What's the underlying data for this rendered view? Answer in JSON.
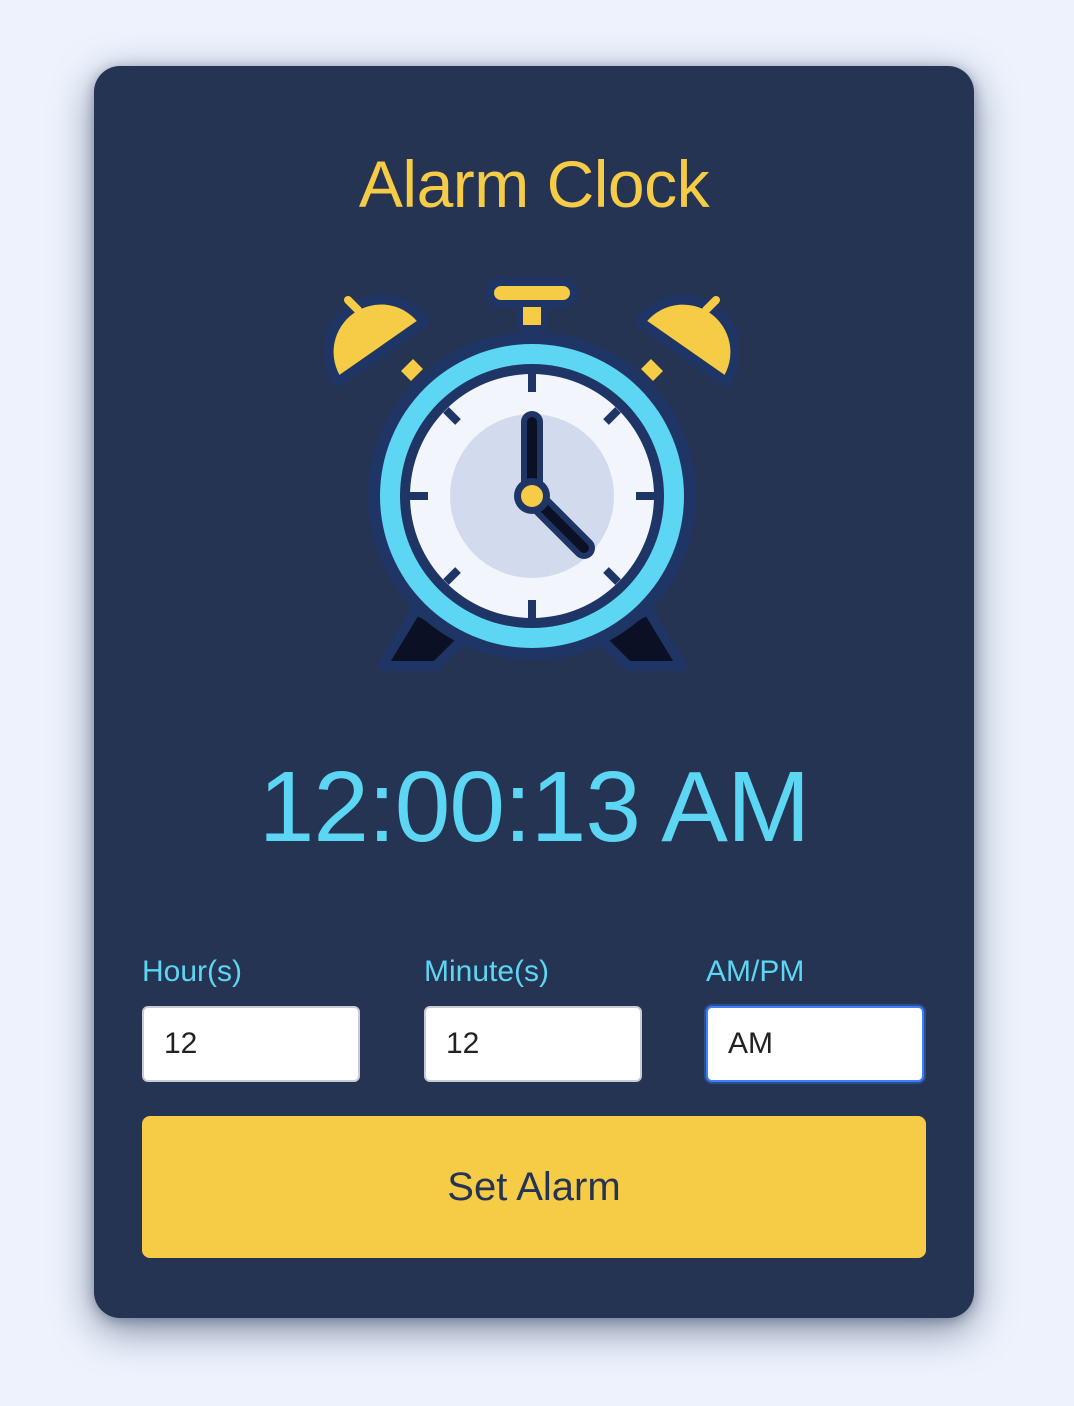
{
  "app": {
    "title": "Alarm Clock",
    "current_time": "12:00:13 AM"
  },
  "form": {
    "hour": {
      "label": "Hour(s)",
      "value": "12"
    },
    "minute": {
      "label": "Minute(s)",
      "value": "12"
    },
    "ampm": {
      "label": "AM/PM",
      "value": "AM"
    },
    "submit_label": "Set Alarm"
  },
  "illustration": {
    "icon": "alarm-clock-icon"
  },
  "colors": {
    "page_background": "#edf2fd",
    "card_background": "#263453",
    "title": "#f6cc46",
    "time": "#5dd6f3",
    "labels": "#5dd6f3",
    "button_background": "#f6cc46",
    "button_text": "#263453"
  }
}
